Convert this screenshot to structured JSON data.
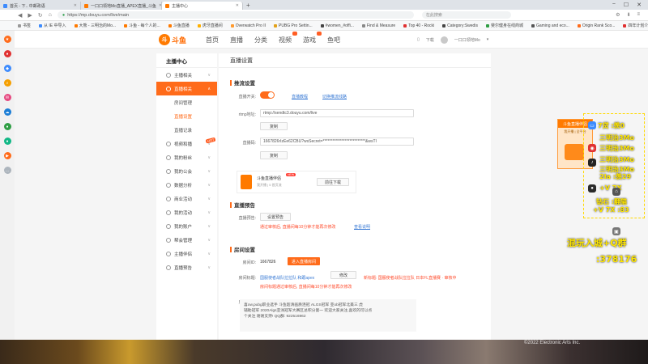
{
  "browser": {
    "tabs": [
      {
        "label": "首页 - 下.. 中邮政语",
        "active": false,
        "color": "#3d8bfd"
      },
      {
        "label": "一口口领地Mo直播_APEX直播_斗鱼",
        "active": false,
        "color": "#ff7a00"
      },
      {
        "label": "主播中心",
        "active": true,
        "color": "#ff7a00"
      }
    ],
    "new_tab": "+",
    "window_controls": [
      "−",
      "☐",
      "✕"
    ],
    "url": "https://mp.douyu.com/live/main",
    "search_placeholder": "在此搜索",
    "bookmarks": [
      {
        "label": "书签",
        "color": "#999999"
      },
      {
        "label": "从 IE 中导入",
        "color": "#3d8bfd"
      },
      {
        "label": "大熊 - 三明治的Mo...",
        "color": "#ff7a00"
      },
      {
        "label": "斗鱼 - 每个人的...",
        "color": "#ff7a00"
      },
      {
        "label": "斗鱼直播",
        "color": "#ff7a00"
      },
      {
        "label": "虎牙直播间",
        "color": "#ffb000"
      },
      {
        "label": "Overwatch Pro II",
        "color": "#ff9a2e"
      },
      {
        "label": "PUBG Pro Settin...",
        "color": "#e3a21a"
      },
      {
        "label": "#women_#offi...",
        "color": "#444444"
      },
      {
        "label": "Find & Measure",
        "color": "#888888"
      },
      {
        "label": "Top 40 - Rocki",
        "color": "#e03131"
      },
      {
        "label": "Category:Swedis",
        "color": "#444444"
      },
      {
        "label": "斐尔健身在线商城",
        "color": "#2f9e44"
      },
      {
        "label": "Gaming and eco...",
        "color": "#555555"
      },
      {
        "label": "Origin Rank Sco...",
        "color": "#ff6b1a"
      },
      {
        "label": "四年计划介绍.",
        "color": "#e03131"
      }
    ]
  },
  "site": {
    "logo_char": "斗",
    "logo_text": "斗鱼",
    "nav": [
      "首页",
      "直播",
      "分类",
      "视频",
      "游戏",
      "鱼吧"
    ],
    "nav_badges": [
      false,
      false,
      false,
      true,
      true,
      false
    ],
    "download": "下载",
    "username": "一口口领地Mo"
  },
  "sidebar": {
    "title": "主播中心",
    "items": [
      {
        "label": "主播相关",
        "type": "group",
        "active": false
      },
      {
        "label": "直播相关",
        "type": "group",
        "active": true
      },
      {
        "label": "房间管理",
        "type": "sub",
        "active": false
      },
      {
        "label": "直播设置",
        "type": "sub",
        "active": true
      },
      {
        "label": "直播记录",
        "type": "sub",
        "active": false
      },
      {
        "label": "视频和播",
        "type": "group",
        "active": false,
        "hot": "HOT"
      },
      {
        "label": "我的粉丝",
        "type": "group",
        "active": false
      },
      {
        "label": "我的公会",
        "type": "group",
        "active": false
      },
      {
        "label": "数据分析",
        "type": "group",
        "active": false
      },
      {
        "label": "商业活动",
        "type": "group",
        "active": false
      },
      {
        "label": "我的活动",
        "type": "group",
        "active": false
      },
      {
        "label": "我的账户",
        "type": "group",
        "active": false
      },
      {
        "label": "帮会管理",
        "type": "group",
        "active": false
      },
      {
        "label": "主播伴侣",
        "type": "group",
        "active": false
      },
      {
        "label": "直播预告",
        "type": "group",
        "active": false
      }
    ]
  },
  "content": {
    "title": "直播设置",
    "push": {
      "heading": "推流设置",
      "switch_label": "直播开关:",
      "help_link": "直播教程",
      "help_link2": "切换推流线路",
      "rtmp_label": "rtmp地址:",
      "rtmp_value": "rtmp://sendtc3.douyu.com/live",
      "copy1": "复制",
      "code_label": "直播码:",
      "code_value": "1667826rIzEe62CBU?wsSecret=***************************&wsTI",
      "copy2": "复制",
      "promo_title": "斗鱼直播伴侣",
      "promo_new": "NEW",
      "promo_sub": "我开播 | 5 首页流",
      "promo_btn": "前往下载"
    },
    "preview": {
      "heading": "直播预告",
      "label": "直播预告:",
      "btn": "设置预告",
      "warn": "通过审核后, 直播间每10分钟才能再次修改",
      "warn_link": "查看说明"
    },
    "room": {
      "heading": "房间设置",
      "id_label": "房间ID:",
      "id_value": "1667826",
      "id_btn": "进入直播房间",
      "title_label": "房间标题:",
      "title_value": "国服使者战队拉拉队 和跟apex",
      "edit_btn": "修改",
      "title_warn": "新标题: 国服使者战队拉拉队 日本FL直播赛 · 审核中",
      "title_note": "房间标题通过审核后, 直播间每10分钟才能再次修改",
      "notice_label": "房间公告:",
      "notice_text": "喜ow,pubg职业选手 斗鱼超清画质连冠 ALGS冠军 亚ob冠军北美三 虎\n辅助冠军 2020Algs亚洲冠军大赛区总积分第一 欢迎大家关注,喜欢的可以点\n个关注 谢谢支持! QQ群: 922516962"
    }
  },
  "overlay": {
    "box_title": "斗鱼直播伴侣",
    "box_sub": "我开播 | 全平台",
    "lines": [
      "7贷 :羡0",
      "三明治3Mo",
      "三明治3Mo",
      "三明治3Mo",
      "三明治3Mo",
      "2Ia :羡29",
      "+V 7X",
      "钻石 :翻猫",
      "+V 7X :83"
    ],
    "group_line1": "混玩入城+Q群",
    "group_line2": ":378176",
    "copyright": "©2022 Electronic Arts Inc."
  },
  "colors": {
    "accent": "#ff6b1a",
    "link": "#3a7bd5",
    "warn": "#ff4a2a",
    "overlay_text": "#ffe600"
  }
}
